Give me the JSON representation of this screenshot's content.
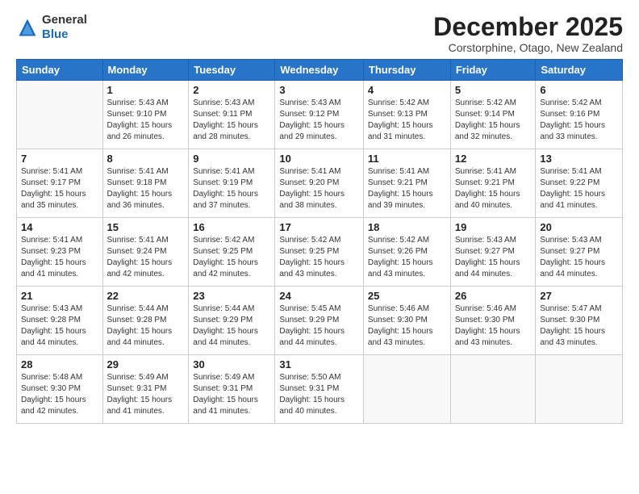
{
  "logo": {
    "general": "General",
    "blue": "Blue"
  },
  "header": {
    "month": "December 2025",
    "location": "Corstorphine, Otago, New Zealand"
  },
  "weekdays": [
    "Sunday",
    "Monday",
    "Tuesday",
    "Wednesday",
    "Thursday",
    "Friday",
    "Saturday"
  ],
  "weeks": [
    [
      {
        "day": "",
        "info": ""
      },
      {
        "day": "1",
        "info": "Sunrise: 5:43 AM\nSunset: 9:10 PM\nDaylight: 15 hours\nand 26 minutes."
      },
      {
        "day": "2",
        "info": "Sunrise: 5:43 AM\nSunset: 9:11 PM\nDaylight: 15 hours\nand 28 minutes."
      },
      {
        "day": "3",
        "info": "Sunrise: 5:43 AM\nSunset: 9:12 PM\nDaylight: 15 hours\nand 29 minutes."
      },
      {
        "day": "4",
        "info": "Sunrise: 5:42 AM\nSunset: 9:13 PM\nDaylight: 15 hours\nand 31 minutes."
      },
      {
        "day": "5",
        "info": "Sunrise: 5:42 AM\nSunset: 9:14 PM\nDaylight: 15 hours\nand 32 minutes."
      },
      {
        "day": "6",
        "info": "Sunrise: 5:42 AM\nSunset: 9:16 PM\nDaylight: 15 hours\nand 33 minutes."
      }
    ],
    [
      {
        "day": "7",
        "info": "Sunrise: 5:41 AM\nSunset: 9:17 PM\nDaylight: 15 hours\nand 35 minutes."
      },
      {
        "day": "8",
        "info": "Sunrise: 5:41 AM\nSunset: 9:18 PM\nDaylight: 15 hours\nand 36 minutes."
      },
      {
        "day": "9",
        "info": "Sunrise: 5:41 AM\nSunset: 9:19 PM\nDaylight: 15 hours\nand 37 minutes."
      },
      {
        "day": "10",
        "info": "Sunrise: 5:41 AM\nSunset: 9:20 PM\nDaylight: 15 hours\nand 38 minutes."
      },
      {
        "day": "11",
        "info": "Sunrise: 5:41 AM\nSunset: 9:21 PM\nDaylight: 15 hours\nand 39 minutes."
      },
      {
        "day": "12",
        "info": "Sunrise: 5:41 AM\nSunset: 9:21 PM\nDaylight: 15 hours\nand 40 minutes."
      },
      {
        "day": "13",
        "info": "Sunrise: 5:41 AM\nSunset: 9:22 PM\nDaylight: 15 hours\nand 41 minutes."
      }
    ],
    [
      {
        "day": "14",
        "info": "Sunrise: 5:41 AM\nSunset: 9:23 PM\nDaylight: 15 hours\nand 41 minutes."
      },
      {
        "day": "15",
        "info": "Sunrise: 5:41 AM\nSunset: 9:24 PM\nDaylight: 15 hours\nand 42 minutes."
      },
      {
        "day": "16",
        "info": "Sunrise: 5:42 AM\nSunset: 9:25 PM\nDaylight: 15 hours\nand 42 minutes."
      },
      {
        "day": "17",
        "info": "Sunrise: 5:42 AM\nSunset: 9:25 PM\nDaylight: 15 hours\nand 43 minutes."
      },
      {
        "day": "18",
        "info": "Sunrise: 5:42 AM\nSunset: 9:26 PM\nDaylight: 15 hours\nand 43 minutes."
      },
      {
        "day": "19",
        "info": "Sunrise: 5:43 AM\nSunset: 9:27 PM\nDaylight: 15 hours\nand 44 minutes."
      },
      {
        "day": "20",
        "info": "Sunrise: 5:43 AM\nSunset: 9:27 PM\nDaylight: 15 hours\nand 44 minutes."
      }
    ],
    [
      {
        "day": "21",
        "info": "Sunrise: 5:43 AM\nSunset: 9:28 PM\nDaylight: 15 hours\nand 44 minutes."
      },
      {
        "day": "22",
        "info": "Sunrise: 5:44 AM\nSunset: 9:28 PM\nDaylight: 15 hours\nand 44 minutes."
      },
      {
        "day": "23",
        "info": "Sunrise: 5:44 AM\nSunset: 9:29 PM\nDaylight: 15 hours\nand 44 minutes."
      },
      {
        "day": "24",
        "info": "Sunrise: 5:45 AM\nSunset: 9:29 PM\nDaylight: 15 hours\nand 44 minutes."
      },
      {
        "day": "25",
        "info": "Sunrise: 5:46 AM\nSunset: 9:30 PM\nDaylight: 15 hours\nand 43 minutes."
      },
      {
        "day": "26",
        "info": "Sunrise: 5:46 AM\nSunset: 9:30 PM\nDaylight: 15 hours\nand 43 minutes."
      },
      {
        "day": "27",
        "info": "Sunrise: 5:47 AM\nSunset: 9:30 PM\nDaylight: 15 hours\nand 43 minutes."
      }
    ],
    [
      {
        "day": "28",
        "info": "Sunrise: 5:48 AM\nSunset: 9:30 PM\nDaylight: 15 hours\nand 42 minutes."
      },
      {
        "day": "29",
        "info": "Sunrise: 5:49 AM\nSunset: 9:31 PM\nDaylight: 15 hours\nand 41 minutes."
      },
      {
        "day": "30",
        "info": "Sunrise: 5:49 AM\nSunset: 9:31 PM\nDaylight: 15 hours\nand 41 minutes."
      },
      {
        "day": "31",
        "info": "Sunrise: 5:50 AM\nSunset: 9:31 PM\nDaylight: 15 hours\nand 40 minutes."
      },
      {
        "day": "",
        "info": ""
      },
      {
        "day": "",
        "info": ""
      },
      {
        "day": "",
        "info": ""
      }
    ]
  ]
}
